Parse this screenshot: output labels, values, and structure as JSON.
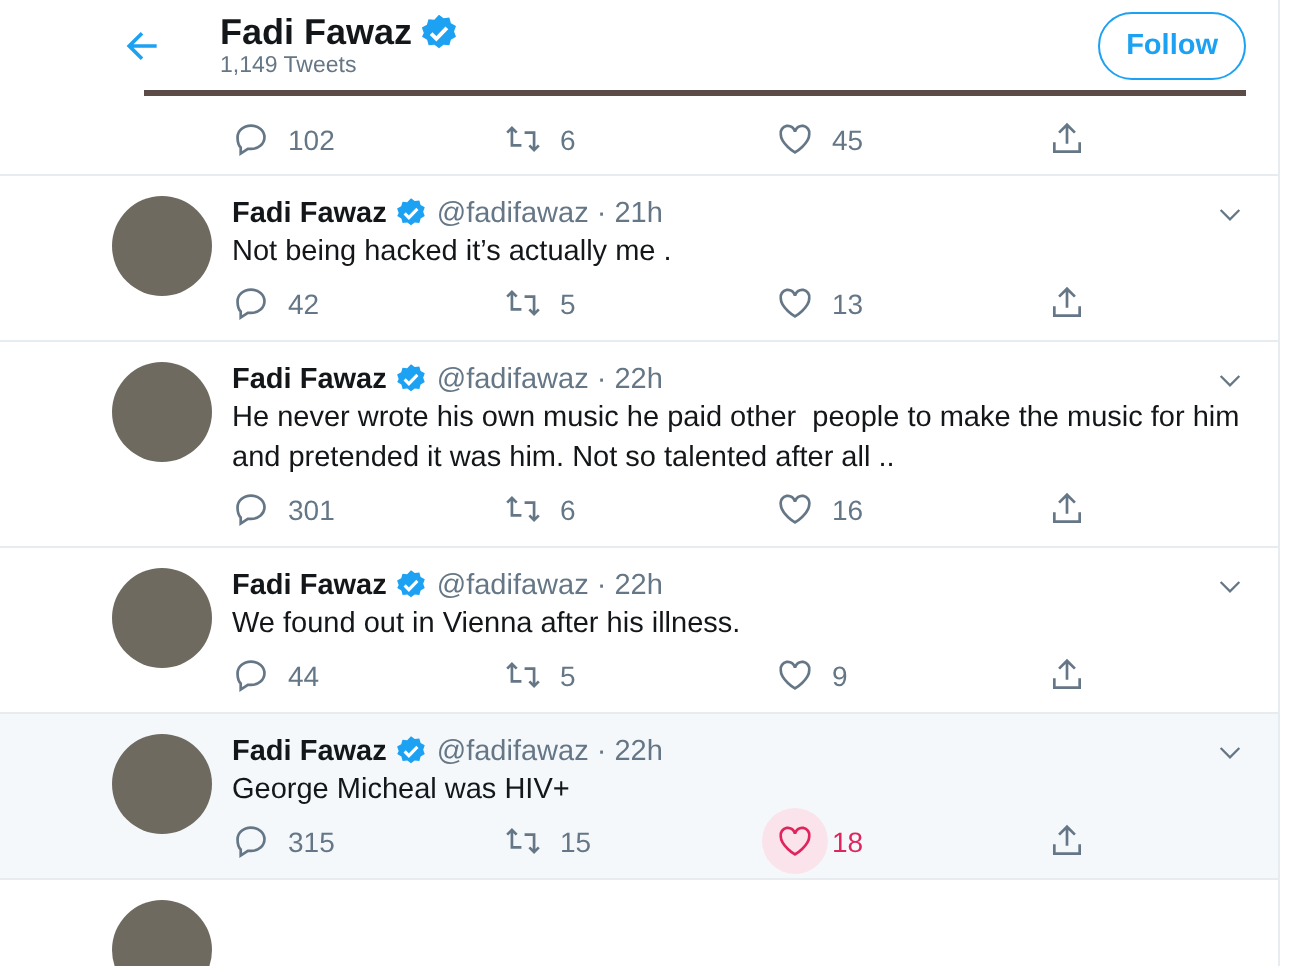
{
  "header": {
    "name": "Fadi Fawaz",
    "verified": true,
    "tweet_count": "1,149 Tweets",
    "follow_button": "Follow"
  },
  "top_tweet_actions": {
    "replies": "102",
    "retweets": "6",
    "likes": "45"
  },
  "tweets": [
    {
      "name": "Fadi Fawaz",
      "verified": true,
      "handle": "@fadifawaz",
      "separator": "·",
      "time": "21h",
      "text": "Not being hacked it’s actually me .",
      "replies": "42",
      "retweets": "5",
      "likes": "13",
      "hovered": false
    },
    {
      "name": "Fadi Fawaz",
      "verified": true,
      "handle": "@fadifawaz",
      "separator": "·",
      "time": "22h",
      "text": "He never wrote his own music he paid other  people to make the music for him and pretended it was him. Not so talented after all ..",
      "replies": "301",
      "retweets": "6",
      "likes": "16",
      "hovered": false
    },
    {
      "name": "Fadi Fawaz",
      "verified": true,
      "handle": "@fadifawaz",
      "separator": "·",
      "time": "22h",
      "text": "We found out in Vienna after his illness.",
      "replies": "44",
      "retweets": "5",
      "likes": "9",
      "hovered": false
    },
    {
      "name": "Fadi Fawaz",
      "verified": true,
      "handle": "@fadifawaz",
      "separator": "·",
      "time": "22h",
      "text": "George Micheal was HIV+",
      "replies": "315",
      "retweets": "15",
      "likes": "18",
      "hovered": true
    }
  ]
}
